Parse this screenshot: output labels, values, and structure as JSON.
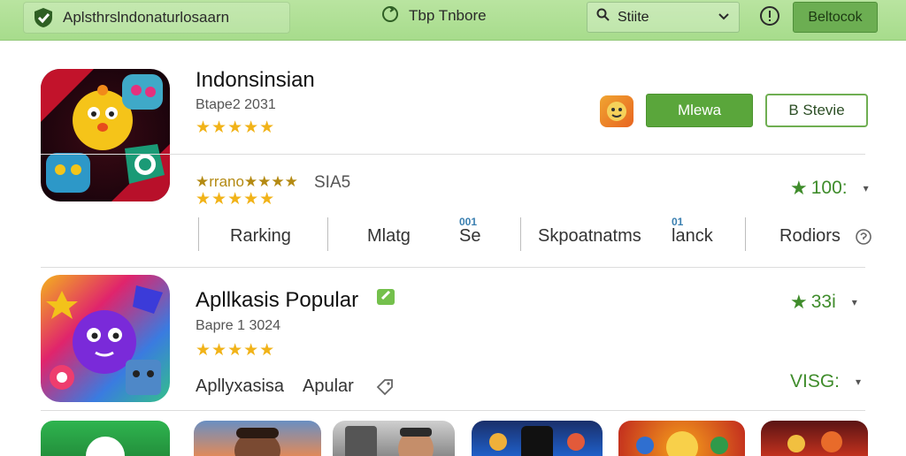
{
  "topbar": {
    "title": "Aplsthrslndonaturlosaarn",
    "center_text": "Tbp Tnbore",
    "search_value": "Stiite",
    "action_button": "Beltocok"
  },
  "app1": {
    "title": "Indonsinsian",
    "subtitle": "Btape2 2031",
    "rating_stars": "★★★★★",
    "primary_button": "Mlewa",
    "secondary_button": "B Stevie",
    "rating_text": "★rrano★★★★",
    "rating_count": "SIA5",
    "stat_value": "100:"
  },
  "tabs": [
    {
      "label": "Rarking",
      "badge": ""
    },
    {
      "label": "Mlatg",
      "badge": ""
    },
    {
      "label": "Se",
      "badge": "001"
    },
    {
      "label": "Skpoatnatms",
      "badge": ""
    },
    {
      "label": "lanck",
      "badge": "01"
    },
    {
      "label": "Rodiors",
      "badge": ""
    }
  ],
  "app2": {
    "title": "Apllkasis Popular",
    "subtitle": "Bapre 1 3024",
    "rating_stars": "★★★★★",
    "category_left": "Apllyxasisa",
    "category_right": "Apular",
    "stat_value": "33i",
    "stat_value_2": "VISG:"
  },
  "colors": {
    "topbar": "#a7dc8c",
    "accent_green": "#5aa63b",
    "star_gold": "#f1b319",
    "stat_green": "#3f8c2b"
  },
  "icons": [
    "check-shield-icon",
    "refresh-icon",
    "search-icon",
    "chevron-down-icon",
    "info-icon",
    "star-icon",
    "tag-icon",
    "help-circle-icon"
  ]
}
